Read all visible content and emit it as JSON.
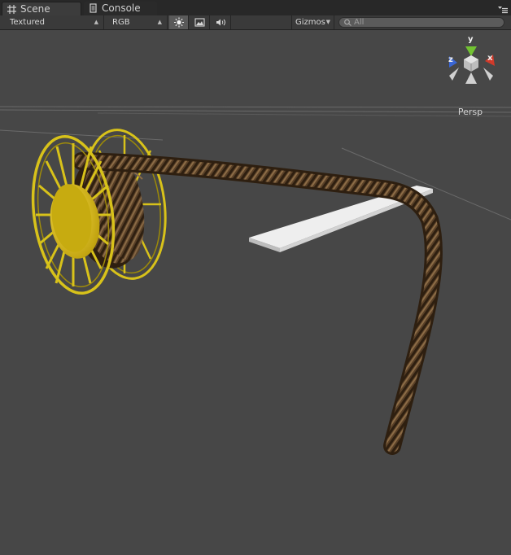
{
  "tabs": [
    {
      "label": "Scene",
      "icon": "grid-icon",
      "active": true
    },
    {
      "label": "Console",
      "icon": "console-icon",
      "active": false
    }
  ],
  "toolbar": {
    "render_mode": "Textured",
    "channel": "RGB",
    "gizmos_label": "Gizmos",
    "search_placeholder": "All"
  },
  "viewport": {
    "projection_label": "Persp",
    "axes": {
      "x": "x",
      "y": "y",
      "z": "z"
    }
  },
  "colors": {
    "background": "#474747",
    "reel": "#d8c21a",
    "rope": "#5a4128",
    "axis_x": "#d03a2a",
    "axis_y": "#72c232",
    "axis_z": "#3a66d4"
  }
}
